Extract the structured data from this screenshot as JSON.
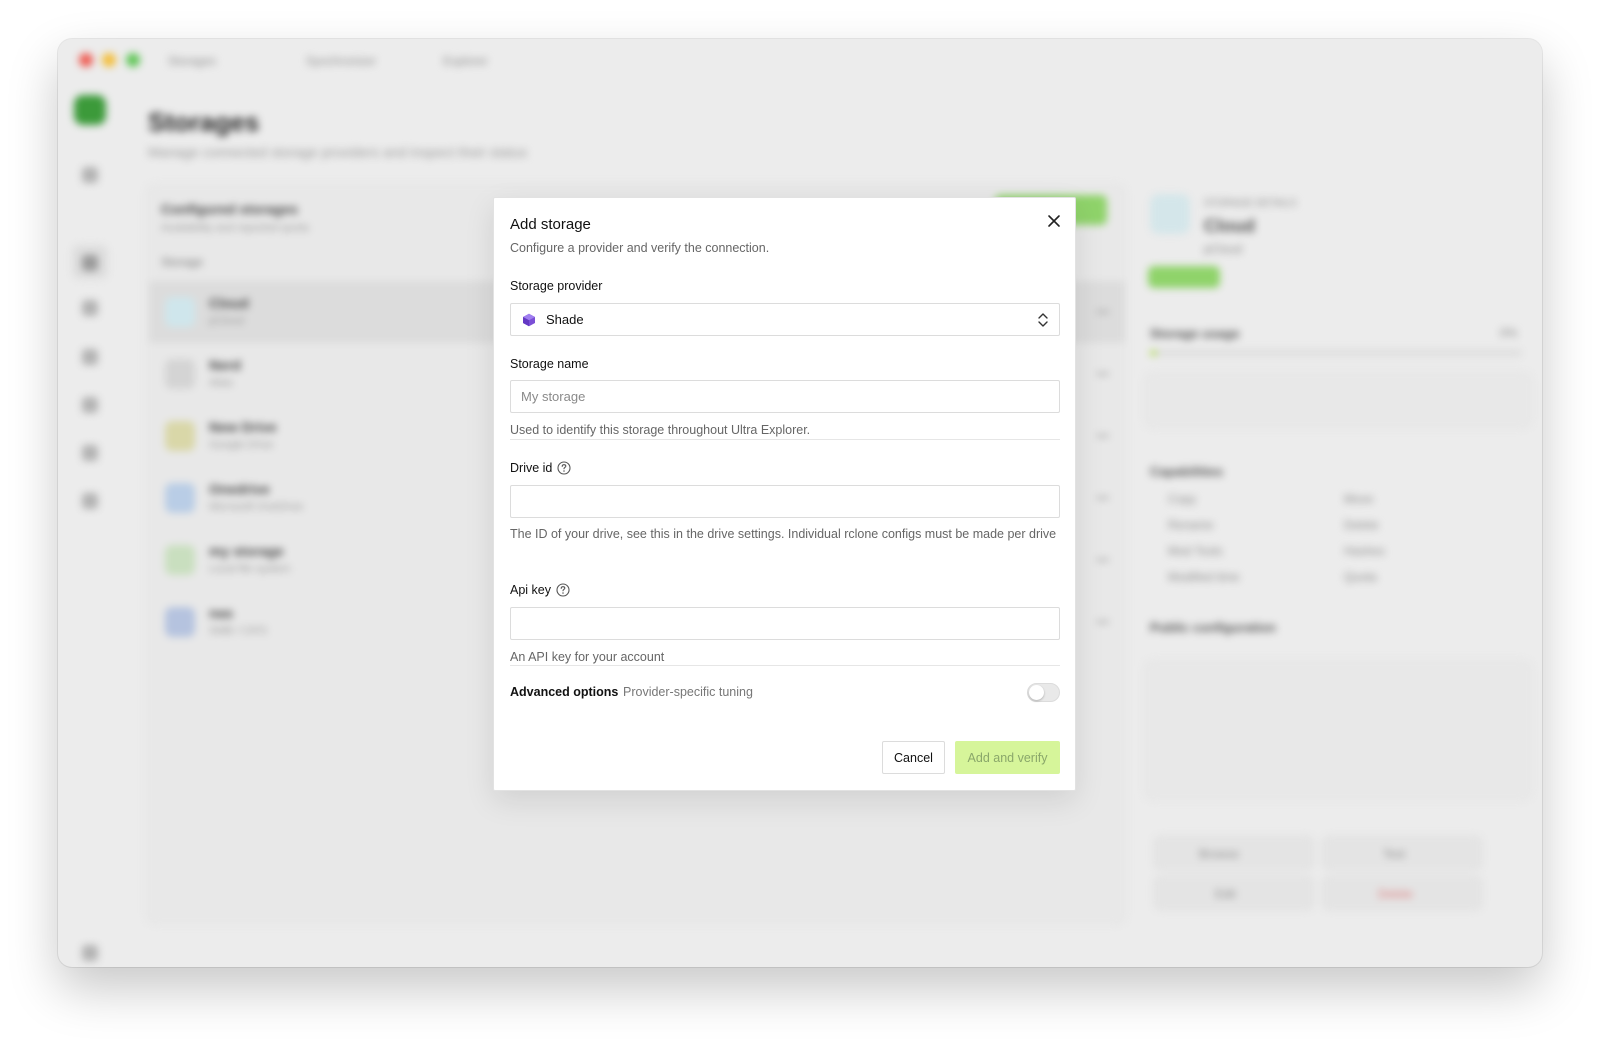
{
  "background": {
    "tabs": [
      "Storages",
      "Synchronizer",
      "Explorer"
    ],
    "page_title": "Storages",
    "page_subtitle": "Manage connected storage providers and inspect their status",
    "list": {
      "title": "Configured storages",
      "subtitle": "Availability and reported quota",
      "column": "Storage",
      "rows": [
        {
          "name": "Cloud",
          "sub": "pCloud"
        },
        {
          "name": "Nerd",
          "sub": "Alias"
        },
        {
          "name": "New Drive",
          "sub": "Google Drive"
        },
        {
          "name": "Onedrive",
          "sub": "Microsoft OneDrive"
        },
        {
          "name": "my storage",
          "sub": "Local file system"
        },
        {
          "name": "nas",
          "sub": "SMB / CIFS"
        }
      ]
    },
    "detail": {
      "section_label": "STORAGE DETAILS",
      "name": "Cloud",
      "provider": "pCloud",
      "usage_label": "Storage usage",
      "usage_percent": "0%",
      "usage_fraction": 0.02,
      "capabilities_label": "Capabilities",
      "capabilities": [
        "Copy",
        "Move",
        "Rename",
        "Delete",
        "Mod Tools",
        "Hashes",
        "Modified time",
        "Quota"
      ],
      "config_label": "Public configuration",
      "browse_label": "Browse",
      "test_label": "Test",
      "edit_label": "Edit",
      "delete_label": "Delete"
    }
  },
  "modal": {
    "title": "Add storage",
    "subtitle": "Configure a provider and verify the connection.",
    "provider_label": "Storage provider",
    "provider_value": "Shade",
    "name_label": "Storage name",
    "name_placeholder": "My storage",
    "name_help": "Used to identify this storage throughout Ultra Explorer.",
    "drive_id_label": "Drive id",
    "drive_id_help": "The ID of your drive, see this in the drive settings. Individual rclone configs must be made per drive",
    "api_key_label": "Api key",
    "api_key_help": "An API key for your account",
    "advanced_label": "Advanced options",
    "advanced_sub": "Provider-specific tuning",
    "advanced_enabled": false,
    "cancel_label": "Cancel",
    "submit_label": "Add and verify"
  },
  "colors": {
    "accent_green": "#d6f59a",
    "provider_icon": "#7b4fd6"
  },
  "icons": {
    "close": "close-icon",
    "chevron": "chevron-up-down-icon",
    "help": "question-circle-icon",
    "provider": "shade-cube-icon"
  }
}
